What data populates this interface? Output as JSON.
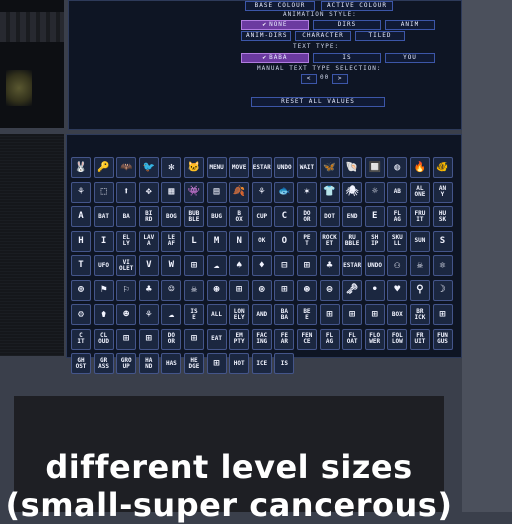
{
  "settings": {
    "base_colour": "BASE COLOUR",
    "active_colour": "ACTIVE COLOUR",
    "animation_style_label": "ANIMATION STYLE:",
    "animation_options": [
      "NONE",
      "DIRS",
      "ANIM",
      "ANIM-DIRS",
      "CHARACTER",
      "TILED"
    ],
    "animation_selected": "NONE",
    "text_type_label": "TEXT TYPE:",
    "text_type_options": [
      "BABA",
      "IS",
      "YOU"
    ],
    "text_type_selected": "BABA",
    "manual_label": "MANUAL TEXT TYPE SELECTION:",
    "manual_prev": "<",
    "manual_value": "00",
    "manual_next": ">",
    "reset_label": "RESET ALL VALUES"
  },
  "tile_grid": [
    [
      "🐰",
      "🔑",
      "🦇",
      "🐦",
      "✻",
      "🐱",
      "MENU",
      "MOVE",
      "RESTART",
      "UNDO",
      "WAIT",
      "🦋",
      "🐚",
      "🔲",
      "◍",
      "🔥"
    ],
    [
      "🐠",
      "⚘",
      "⬚",
      "⬆",
      "✥",
      "▦",
      "👾",
      "▤",
      "🍂",
      "⚘",
      "🐟",
      "✶",
      "👕",
      "🕷",
      "☼",
      "AB"
    ],
    [
      "AL\nONE",
      "AN\nY",
      "A",
      "BAT",
      "BA",
      "BI\nRD",
      "BOG",
      "BUB\nBLE",
      "BUG",
      "B\nOX",
      "CUP",
      "C",
      "DO\nOR",
      "DOT",
      "END",
      "E"
    ],
    [
      "FL\nAG",
      "FRU\nIT",
      "HU\nSK",
      "H",
      "I",
      "EL\nLY",
      "LAV\nA",
      "LE\nAF",
      "L",
      "M",
      "N",
      "OK",
      "O",
      "PE\nT",
      "ROCK\nET",
      "RU\nBBLE",
      "SH\nIP"
    ],
    [
      "SKU\nLL",
      "SUN",
      "S",
      "T",
      "UFO",
      "VI\nOLET",
      "V",
      "W",
      "⊞",
      "☁",
      "♠",
      "♦",
      "⊟",
      "⊞",
      "♣",
      "RESTART"
    ],
    [
      "UNDO",
      "⚇",
      "☠",
      "⚛",
      "⊕",
      "⚑",
      "⚐",
      "♣",
      "☺",
      "☠",
      "⊛",
      "⊞",
      "⊚",
      "⊞",
      "⊛",
      "⊜"
    ],
    [
      "🗝",
      "•",
      "♥",
      "⚲",
      "☽",
      "⚙",
      "⚱",
      "☻",
      "⚘",
      "☁",
      "IS\nE",
      "ALL",
      "LON\nELY",
      "AND",
      "BA\nBA",
      "BE\nE"
    ],
    [
      "⊞",
      "⊞",
      "⊞",
      "BOX",
      "BR\nICK",
      "⊞",
      "C\nIT",
      "CL\nOUD",
      "⊞",
      "⊞",
      "DO\nOR",
      "⊞",
      "EAT",
      "EM\nPTY",
      "FAC\nING",
      "FE\nAR"
    ],
    [
      "FEN\nCE",
      "FL\nAG",
      "FL\nOAT",
      "FLO\nWER",
      "FOL\nLOW",
      "FR\nUIT",
      "FUN\nGUS",
      "GH\nOST",
      "GR\nASS",
      "GRO\nUP",
      "HA\nND",
      "HAS",
      "HE\nDGE",
      "⊞",
      "HOT",
      "ICE",
      "IS"
    ]
  ]
}
